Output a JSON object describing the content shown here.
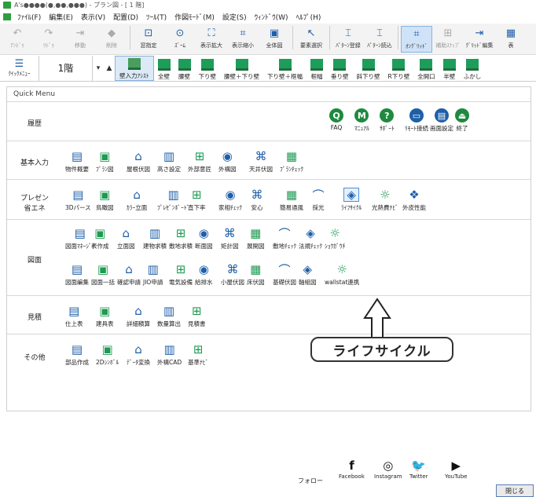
{
  "window": {
    "title": "A's●●●●(●,●●,●●●) - プラン図 - [ 1 階]"
  },
  "menu": [
    "ﾌｧｲﾙ(F)",
    "編集(E)",
    "表示(V)",
    "配置(D)",
    "ﾂｰﾙ(T)",
    "作図ﾓｰﾄﾞ(M)",
    "設定(S)",
    "ｳｨﾝﾄﾞｳ(W)",
    "ﾍﾙﾌﾟ(H)"
  ],
  "toolbar": [
    {
      "label": "ｱﾝﾄﾞｩ",
      "icon": "undo-icon",
      "glyph": "↶",
      "state": "dis"
    },
    {
      "label": "ﾘﾄﾞｩ",
      "icon": "redo-icon",
      "glyph": "↷",
      "state": "dis"
    },
    {
      "label": "移動",
      "icon": "move-icon",
      "glyph": "⇥",
      "state": "dis"
    },
    {
      "label": "削除",
      "icon": "delete-icon",
      "glyph": "◆",
      "state": "dis"
    },
    {
      "label": "窓指定",
      "icon": "window-select-icon",
      "glyph": "⊡",
      "state": ""
    },
    {
      "label": "ｽﾞｰﾑ",
      "icon": "zoom-icon",
      "glyph": "⊙",
      "state": ""
    },
    {
      "label": "表示拡大",
      "icon": "zoom-in-icon",
      "glyph": "⛶",
      "state": ""
    },
    {
      "label": "表示縮小",
      "icon": "zoom-out-icon",
      "glyph": "⌗",
      "state": ""
    },
    {
      "label": "全体図",
      "icon": "overview-icon",
      "glyph": "▣",
      "state": ""
    },
    {
      "label": "要素選択",
      "icon": "pointer-icon",
      "glyph": "↖",
      "state": ""
    },
    {
      "label": "ﾊﾟﾀｰﾝ登録",
      "icon": "pattern-register-icon",
      "glyph": "⌶",
      "state": ""
    },
    {
      "label": "ﾊﾟﾀｰﾝ読込",
      "icon": "pattern-load-icon",
      "glyph": "⌶",
      "state": ""
    },
    {
      "label": "ｵﾝｸﾞﾘｯﾄﾞ",
      "icon": "on-grid-icon",
      "glyph": "⌗",
      "state": "act"
    },
    {
      "label": "補助ｽﾅｯﾌﾟ",
      "icon": "snap-icon",
      "glyph": "⊞",
      "state": "dis"
    },
    {
      "label": "ｸﾞﾘｯﾄﾞ編集",
      "icon": "grid-edit-icon",
      "glyph": "⇥",
      "state": ""
    },
    {
      "label": "表",
      "icon": "table-icon",
      "glyph": "▦",
      "state": ""
    }
  ],
  "ribbon": {
    "quick_menu": "ｸｲｯｸﾒﾆｭｰ",
    "floor": "1階",
    "walls": [
      "壁入力ｱｼｽﾄ",
      "全壁",
      "腰壁",
      "下り壁",
      "腰壁＋下り壁",
      "下り壁＋框幅",
      "框幅",
      "垂り壁",
      "斜下り壁",
      "R下り壁",
      "全開口",
      "半壁",
      "ふかし"
    ]
  },
  "quickmenu": {
    "title": "Quick Menu",
    "rows": [
      {
        "label": "履歴",
        "items": [
          {
            "t": "FAQ",
            "icon": "faq-icon",
            "c": "#1e8a3e",
            "g": "Q"
          },
          {
            "t": "ﾏﾆｭｱﾙ",
            "icon": "manual-icon",
            "c": "#1e8a3e",
            "g": "M"
          },
          {
            "t": "ｻﾎﾟｰﾄ",
            "icon": "support-icon",
            "c": "#1e8a3e",
            "g": "?"
          },
          {
            "t": "ﾘﾓｰﾄ接続",
            "icon": "remote-icon",
            "c": "#1e5fa8",
            "g": "▭"
          },
          {
            "t": "画面設定",
            "icon": "screen-setting-icon",
            "c": "#1e5fa8",
            "g": "▤"
          },
          {
            "t": "終了",
            "icon": "exit-icon",
            "c": "#1e8a3e",
            "g": "⏏"
          }
        ]
      },
      {
        "label": "基本入力",
        "items": [
          "物件概要",
          "ﾌﾟﾗﾝ図",
          "屋根伏図",
          "高さ設定",
          "外部意匠",
          "外構図",
          "天井伏図",
          "ﾌﾟﾗﾝﾁｪｯｸ"
        ]
      },
      {
        "label": "プレゼン\n省エネ",
        "items": [
          "3Dパース",
          "鳥瞰図",
          "ｶﾗｰ立面",
          "ﾌﾟﾚｾﾞﾝﾎﾞｰﾄﾞ",
          "直下率",
          "家相ﾁｪｯｸ",
          "安心",
          "簡易通風",
          "採光",
          "ﾗｲﾌｻｲｸﾙ",
          "光熱費ﾅﾋﾞ",
          "外皮性能"
        ]
      },
      {
        "label": "図面",
        "items1": [
          "図面ﾏﾈｰｼﾞｬ",
          "表作成",
          "立面図",
          "建物求積",
          "敷地求積",
          "断面図",
          "矩計図",
          "展開図",
          "敷地ﾁｪｯｸ",
          "法規ﾁｪｯｸ",
          "ｼｮｳｶﾞｳﾁ"
        ],
        "items2": [
          "図面編集",
          "図面一括",
          "確認申請",
          "JIO申請",
          "電気設備",
          "給排水",
          "小屋伏図",
          "床伏図",
          "基礎伏図",
          "軸組図",
          "wallstat連携"
        ]
      },
      {
        "label": "見積",
        "items": [
          "仕上表",
          "建具表",
          "詳細積算",
          "数量算出",
          "見積書"
        ]
      },
      {
        "label": "その他",
        "items": [
          "部品作成",
          "2Dｼﾝﾎﾞﾙ",
          "ﾃﾞｰﾀ変換",
          "外構CAD",
          "基準ﾅﾋﾞ"
        ]
      }
    ],
    "callout": "ライフサイクル",
    "follow": "フォロー",
    "social": [
      {
        "t": "Facebook",
        "g": "f"
      },
      {
        "t": "Instagram",
        "g": "◎"
      },
      {
        "t": "Twitter",
        "g": "🐦"
      },
      {
        "t": "YouTube",
        "g": "▶"
      }
    ],
    "close": "閉じる"
  }
}
